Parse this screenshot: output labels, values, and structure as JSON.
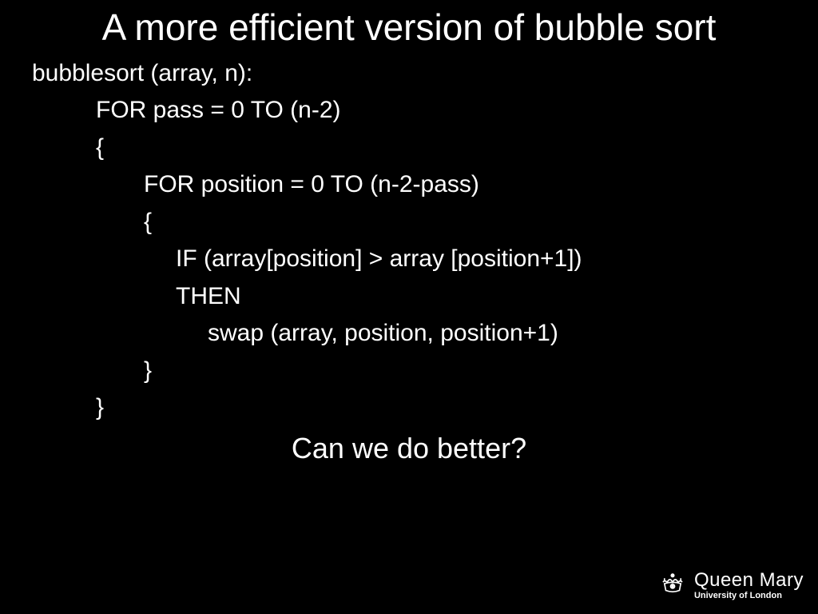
{
  "title": "A more efficient version of bubble sort",
  "code": {
    "l0": "bubblesort (array, n):",
    "l1": "FOR pass = 0 TO (n-2)",
    "l2": "{",
    "l3": "FOR position = 0 TO (n-2-pass)",
    "l4": "{",
    "l5": "IF (array[position] > array [position+1])",
    "l6": "THEN",
    "l7": "swap (array, position, position+1)",
    "l8": "}",
    "l9": "}"
  },
  "question": "Can we do better?",
  "logo": {
    "main": "Queen Mary",
    "sub": "University of London"
  }
}
